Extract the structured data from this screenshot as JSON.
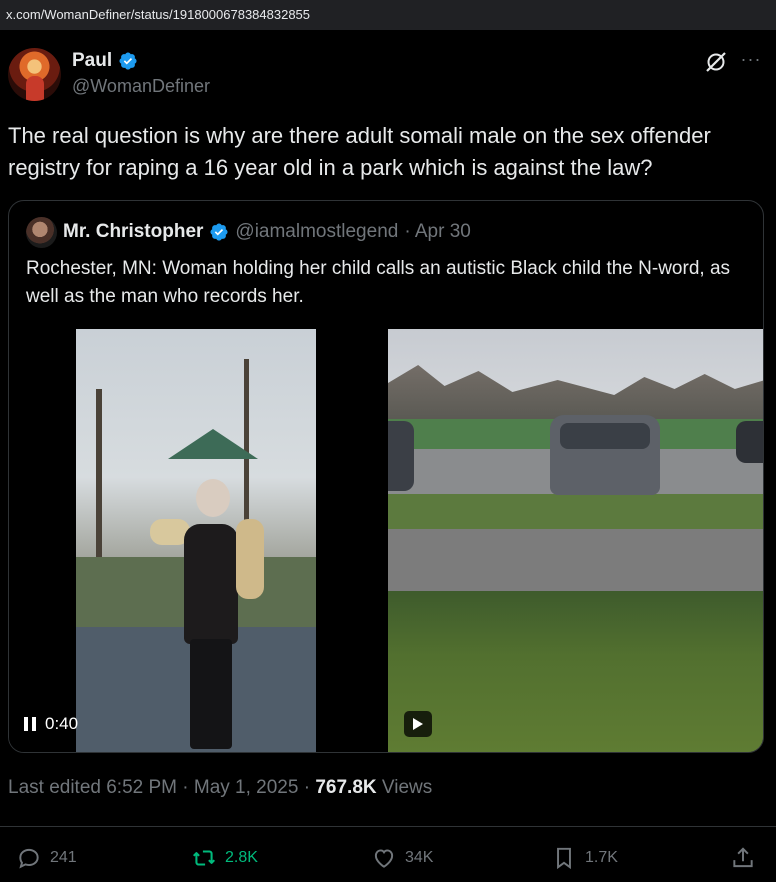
{
  "browser": {
    "url": "x.com/WomanDefiner/status/1918000678384832855"
  },
  "post": {
    "author_name": "Paul",
    "author_handle": "@WomanDefiner",
    "text": "The real question is why are there adult somali male on the sex offender registry for raping a 16 year old in a park which is against the law?",
    "more_icon": "···",
    "icons": {
      "verified": "verified-badge-icon",
      "grok": "grok-icon",
      "more": "more-icon"
    },
    "colors": {
      "verified": "#1d9bf0",
      "retweet": "#00ba7c",
      "muted": "#71767b",
      "text": "#e7e9ea"
    }
  },
  "quote": {
    "author_name": "Mr. Christopher",
    "author_handle": "@iamalmostlegend",
    "date": "· Apr 30",
    "text": "Rochester, MN: Woman holding her child calls an autistic Black child the N-word, as well as the man who records her.",
    "video_time": "0:40"
  },
  "meta": {
    "edited": "Last edited 6:52 PM · May 1, 2025 ·",
    "views_count": "767.8K",
    "views_label": "Views"
  },
  "actions": {
    "replies": "241",
    "reposts": "2.8K",
    "likes": "34K",
    "bookmarks": "1.7K"
  }
}
